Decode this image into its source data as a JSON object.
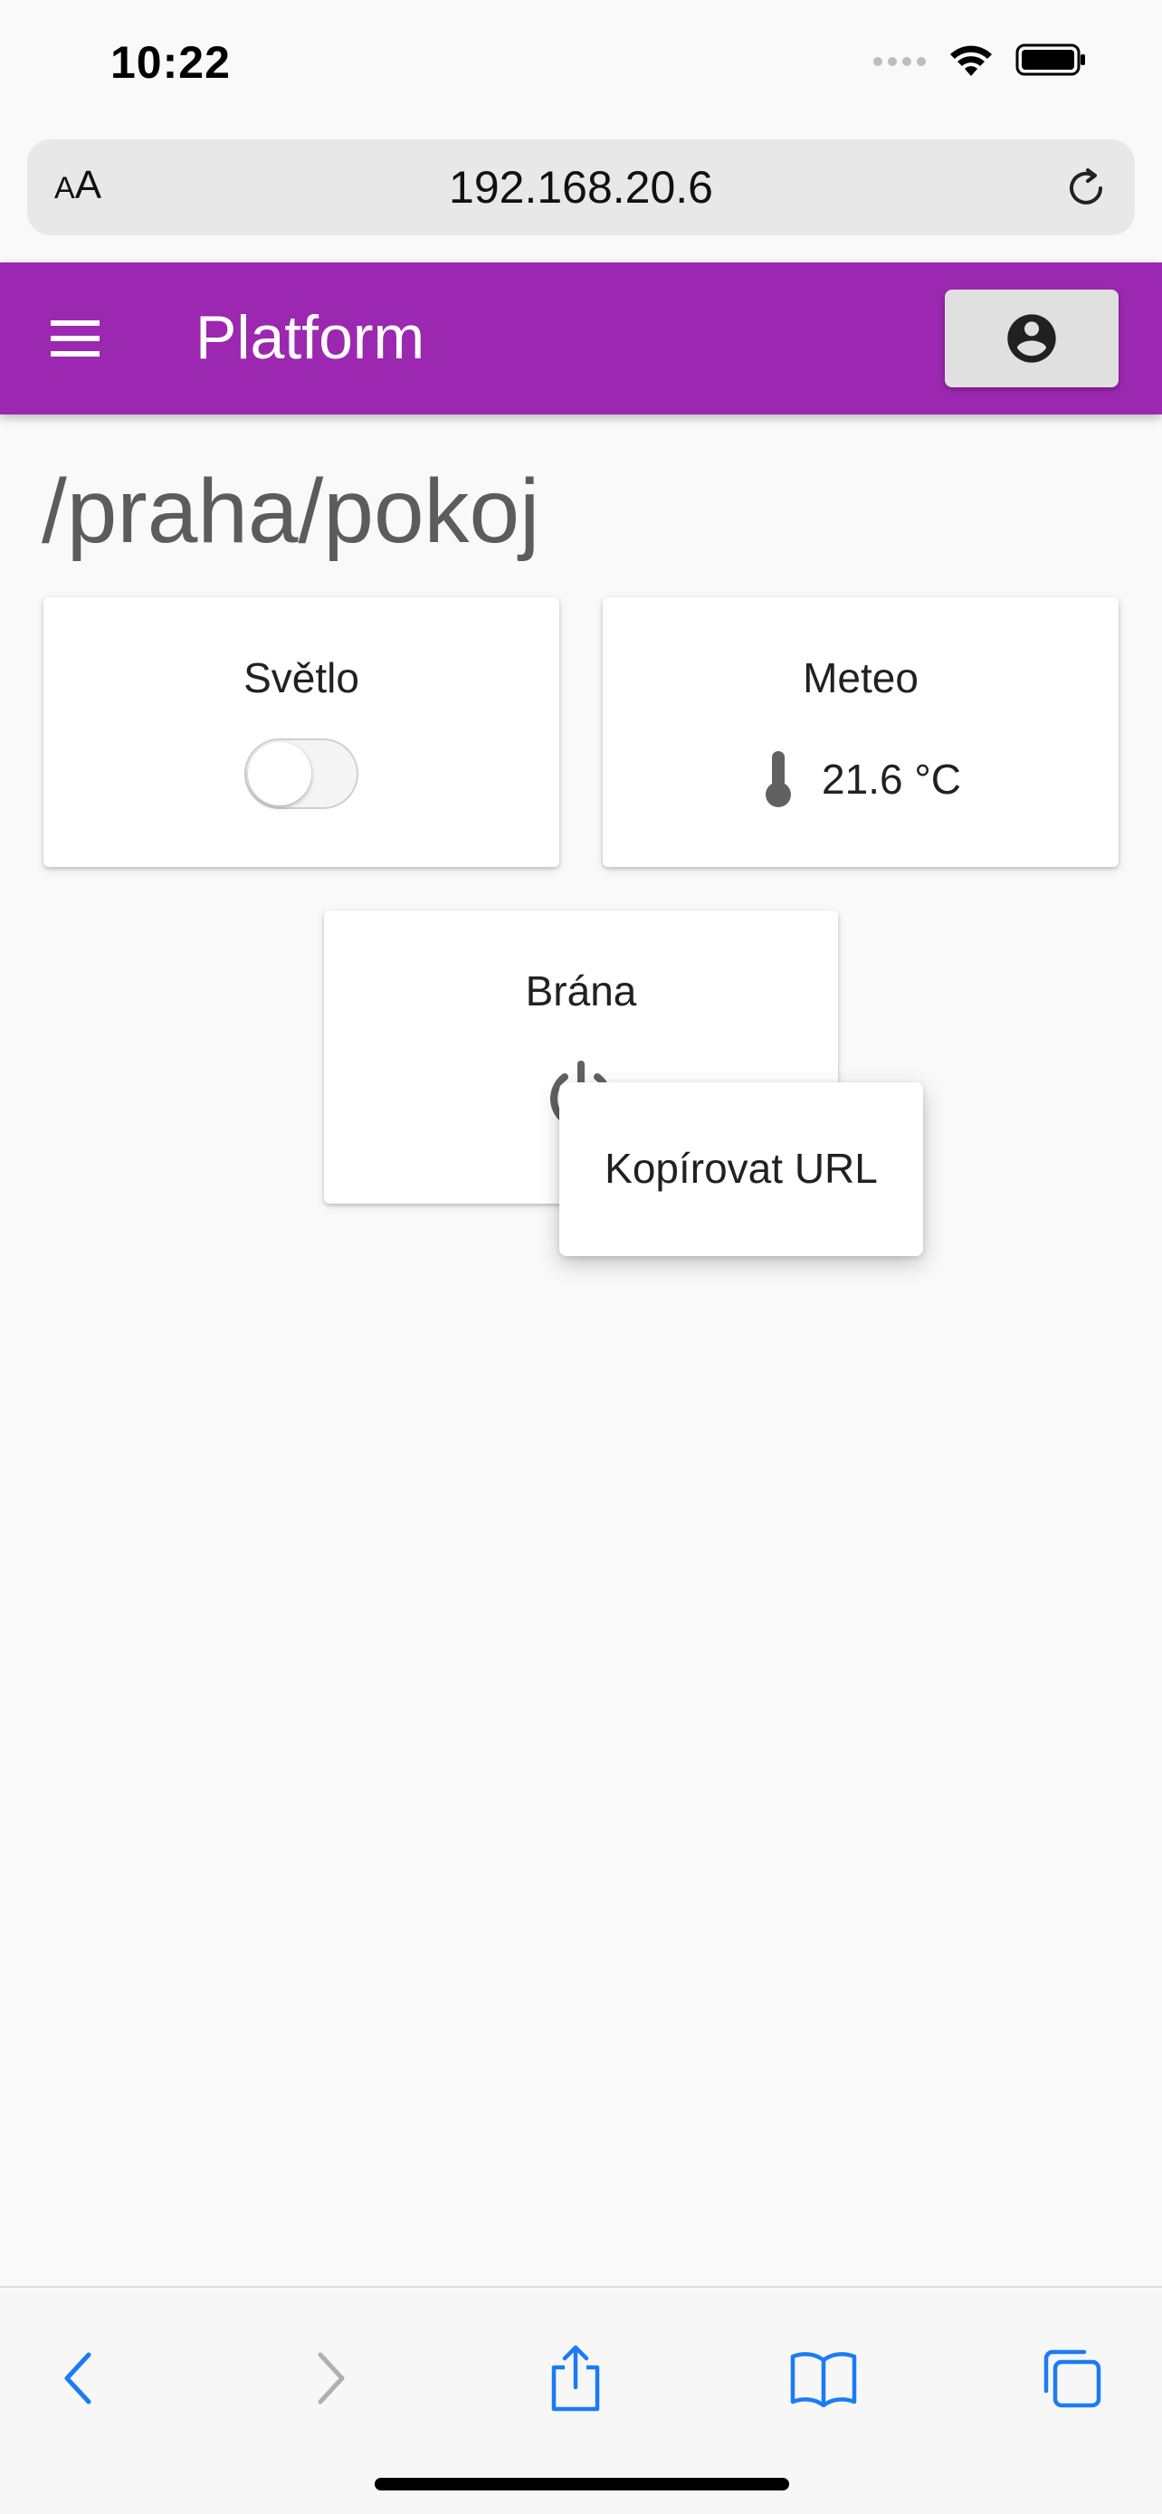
{
  "status_bar": {
    "time": "10:22"
  },
  "browser": {
    "text_size_small": "A",
    "text_size_large": "A",
    "url": "192.168.20.6"
  },
  "app": {
    "title": "Platform"
  },
  "page": {
    "path": "/praha/pokoj"
  },
  "cards": {
    "light": {
      "title": "Světlo",
      "toggle_on": false
    },
    "meteo": {
      "title": "Meteo",
      "value": "21.6 °C"
    },
    "gate": {
      "title": "Brána"
    }
  },
  "context_menu": {
    "item": "Kopírovat URL"
  },
  "colors": {
    "primary": "#9c27b0",
    "ios_blue": "#1a7cf5"
  },
  "icons": {
    "toolbar": [
      "menu-icon",
      "account-circle-icon"
    ],
    "browser": [
      "reload-icon",
      "back-icon",
      "forward-icon",
      "share-icon",
      "bookmarks-icon",
      "tabs-icon"
    ],
    "cards": [
      "thermometer-icon",
      "power-icon"
    ]
  }
}
